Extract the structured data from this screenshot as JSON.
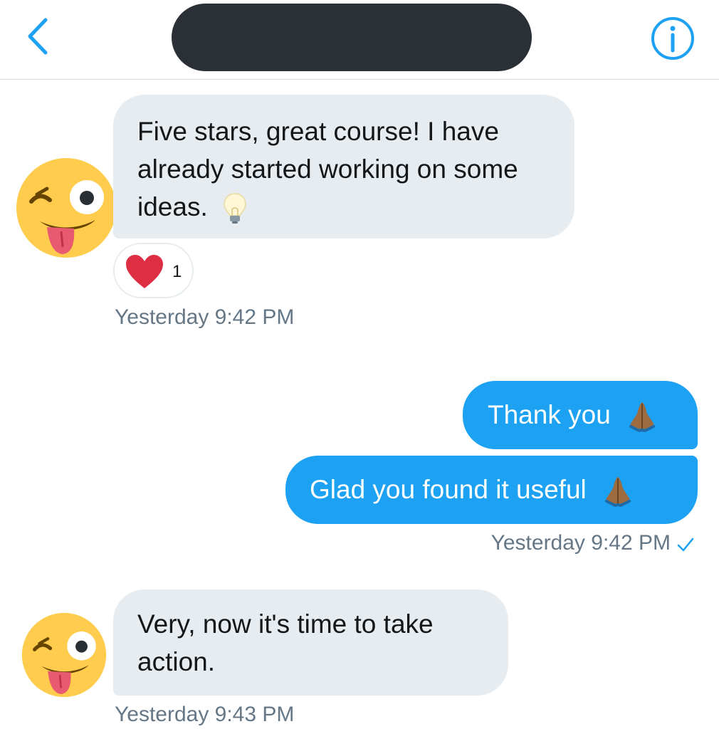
{
  "header": {
    "back_icon": "chevron-left-icon",
    "info_icon": "info-icon",
    "title_redacted": true,
    "accent_color": "#1da1f2"
  },
  "messages": [
    {
      "direction": "incoming",
      "text": "Five stars, great course! I have already started working on some ideas.",
      "emoji": "light-bulb"
    },
    {
      "direction": "outgoing",
      "text": "Thank you",
      "emoji": "folded-hands"
    },
    {
      "direction": "outgoing",
      "text": "Glad you found it useful",
      "emoji": "folded-hands"
    },
    {
      "direction": "incoming",
      "text": "Very, now it's time to take action.",
      "emoji": ""
    }
  ],
  "reaction": {
    "icon": "heart-icon",
    "count": "1"
  },
  "timestamps": {
    "first": "Yesterday 9:42 PM",
    "second": "Yesterday 9:42 PM",
    "third": "Yesterday 9:43 PM"
  },
  "colors": {
    "incoming_bubble": "#e6ecf0",
    "outgoing_bubble": "#1da1f2",
    "timestamp": "#657786"
  }
}
